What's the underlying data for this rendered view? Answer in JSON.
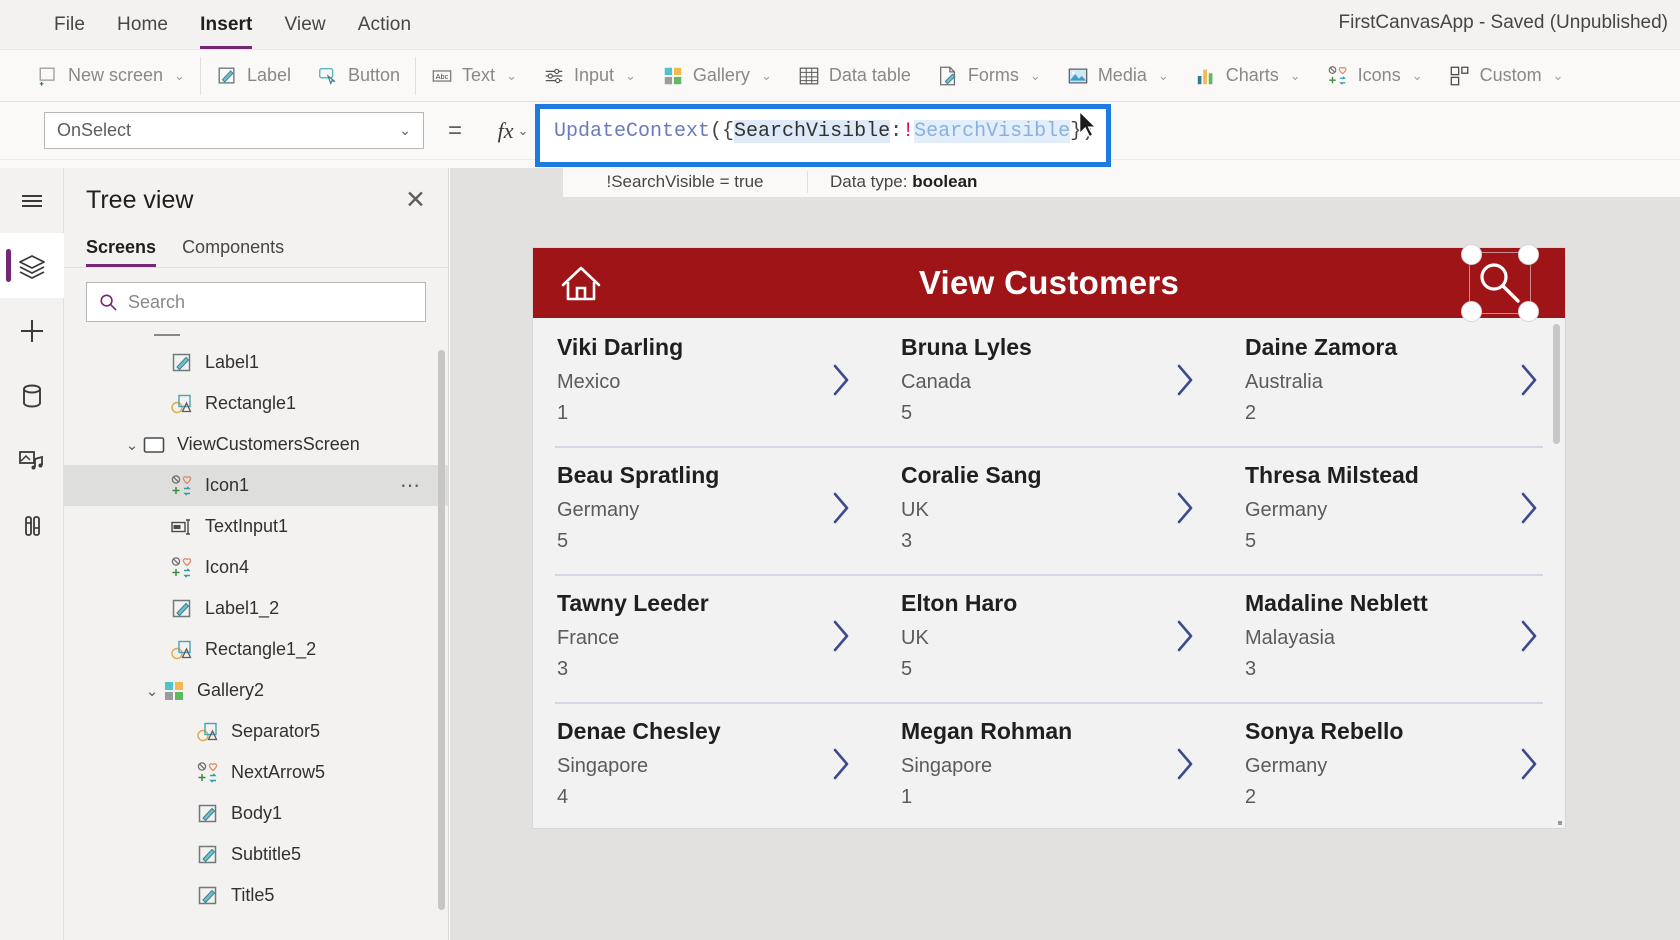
{
  "menubar": {
    "items": [
      {
        "label": "File",
        "active": false
      },
      {
        "label": "Home",
        "active": false
      },
      {
        "label": "Insert",
        "active": true
      },
      {
        "label": "View",
        "active": false
      },
      {
        "label": "Action",
        "active": false
      }
    ],
    "app_title": "FirstCanvasApp - Saved (Unpublished)"
  },
  "ribbon": {
    "items": [
      {
        "label": "New screen",
        "icon": "new-screen-icon",
        "caret": true
      },
      {
        "label": "Label",
        "icon": "label-icon",
        "caret": false
      },
      {
        "label": "Button",
        "icon": "button-icon",
        "caret": false
      },
      {
        "label": "Text",
        "icon": "text-icon",
        "caret": true
      },
      {
        "label": "Input",
        "icon": "input-icon",
        "caret": true
      },
      {
        "label": "Gallery",
        "icon": "gallery-icon",
        "caret": true
      },
      {
        "label": "Data table",
        "icon": "data-table-icon",
        "caret": false
      },
      {
        "label": "Forms",
        "icon": "forms-icon",
        "caret": true
      },
      {
        "label": "Media",
        "icon": "media-icon",
        "caret": true
      },
      {
        "label": "Charts",
        "icon": "charts-icon",
        "caret": true
      },
      {
        "label": "Icons",
        "icon": "icons-icon",
        "caret": true
      },
      {
        "label": "Custom",
        "icon": "custom-icon",
        "caret": true
      }
    ]
  },
  "formula_bar": {
    "property": "OnSelect",
    "equals": "=",
    "fx": "fx",
    "formula_tokens": [
      {
        "text": "UpdateContext",
        "kind": "fn"
      },
      {
        "text": "({",
        "kind": "paren"
      },
      {
        "text": "SearchVisible",
        "kind": "key"
      },
      {
        "text": ": ",
        "kind": "paren"
      },
      {
        "text": "!",
        "kind": "bang"
      },
      {
        "text": "SearchVisible",
        "kind": "var"
      },
      {
        "text": "})",
        "kind": "paren"
      }
    ],
    "formula_text": "UpdateContext({SearchVisible: !SearchVisible})",
    "hint_expression": "!SearchVisible  =  true",
    "hint_datatype_label": "Data type:",
    "hint_datatype_value": "boolean"
  },
  "rail": {
    "items": [
      {
        "name": "hamburger-menu-icon",
        "selected": false
      },
      {
        "name": "tree-view-icon",
        "selected": true
      },
      {
        "name": "insert-plus-icon",
        "selected": false
      },
      {
        "name": "data-icon",
        "selected": false
      },
      {
        "name": "media-icon",
        "selected": false
      },
      {
        "name": "advanced-tools-icon",
        "selected": false
      }
    ]
  },
  "tree_panel": {
    "title": "Tree view",
    "close": "✕",
    "tabs": [
      {
        "label": "Screens",
        "active": true
      },
      {
        "label": "Components",
        "active": false
      }
    ],
    "search_placeholder": "Search",
    "items": [
      {
        "label": "Label1",
        "icon": "label-icon",
        "indent": 2,
        "chevron": "",
        "selected": false,
        "dots": false
      },
      {
        "label": "Rectangle1",
        "icon": "shape-icon",
        "indent": 2,
        "chevron": "",
        "selected": false,
        "dots": false
      },
      {
        "label": "ViewCustomersScreen",
        "icon": "screen-icon",
        "indent": 0,
        "chevron": "⌄",
        "selected": false,
        "dots": false
      },
      {
        "label": "Icon1",
        "icon": "icons-icon",
        "indent": 2,
        "chevron": "",
        "selected": true,
        "dots": true
      },
      {
        "label": "TextInput1",
        "icon": "textinput-icon",
        "indent": 2,
        "chevron": "",
        "selected": false,
        "dots": false
      },
      {
        "label": "Icon4",
        "icon": "icons-icon",
        "indent": 2,
        "chevron": "",
        "selected": false,
        "dots": false
      },
      {
        "label": "Label1_2",
        "icon": "label-icon",
        "indent": 2,
        "chevron": "",
        "selected": false,
        "dots": false
      },
      {
        "label": "Rectangle1_2",
        "icon": "shape-icon",
        "indent": 2,
        "chevron": "",
        "selected": false,
        "dots": false
      },
      {
        "label": "Gallery2",
        "icon": "gallery-icon",
        "indent": 1,
        "chevron": "⌄",
        "selected": false,
        "dots": false
      },
      {
        "label": "Separator5",
        "icon": "shape-icon",
        "indent": 3,
        "chevron": "",
        "selected": false,
        "dots": false
      },
      {
        "label": "NextArrow5",
        "icon": "icons-icon",
        "indent": 3,
        "chevron": "",
        "selected": false,
        "dots": false
      },
      {
        "label": "Body1",
        "icon": "label-icon",
        "indent": 3,
        "chevron": "",
        "selected": false,
        "dots": false
      },
      {
        "label": "Subtitle5",
        "icon": "label-icon",
        "indent": 3,
        "chevron": "",
        "selected": false,
        "dots": false
      },
      {
        "label": "Title5",
        "icon": "label-icon",
        "indent": 3,
        "chevron": "",
        "selected": false,
        "dots": false
      }
    ]
  },
  "canvas": {
    "screen_header": {
      "title": "View Customers",
      "home_icon": "home-icon",
      "search_icon": "search-icon",
      "bg_color": "#9e1417",
      "selected": true
    },
    "gallery": {
      "rows": [
        [
          {
            "name": "Viki  Darling",
            "country": "Mexico",
            "value": "1"
          },
          {
            "name": "Bruna  Lyles",
            "country": "Canada",
            "value": "5"
          },
          {
            "name": "Daine  Zamora",
            "country": "Australia",
            "value": "2"
          }
        ],
        [
          {
            "name": "Beau  Spratling",
            "country": "Germany",
            "value": "5"
          },
          {
            "name": "Coralie  Sang",
            "country": "UK",
            "value": "3"
          },
          {
            "name": "Thresa  Milstead",
            "country": "Germany",
            "value": "5"
          }
        ],
        [
          {
            "name": "Tawny  Leeder",
            "country": "France",
            "value": "3"
          },
          {
            "name": "Elton  Haro",
            "country": "UK",
            "value": "5"
          },
          {
            "name": "Madaline  Neblett",
            "country": "Malayasia",
            "value": "3"
          }
        ],
        [
          {
            "name": "Denae  Chesley",
            "country": "Singapore",
            "value": "4"
          },
          {
            "name": "Megan  Rohman",
            "country": "Singapore",
            "value": "1"
          },
          {
            "name": "Sonya  Rebello",
            "country": "Germany",
            "value": "2"
          }
        ]
      ]
    }
  },
  "colors": {
    "accent_purple": "#742774",
    "selection_blue": "#1f7ae0",
    "header_red": "#9e1417",
    "chevron_blue": "#3b4a8c"
  }
}
